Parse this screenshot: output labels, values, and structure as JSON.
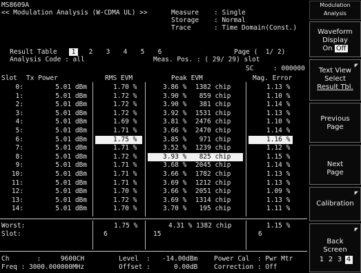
{
  "header": {
    "model": "MS8609A",
    "title": "<< Modulation Analysis (W-CDMA UL) >>",
    "rows": [
      {
        "label": "Measure",
        "value": ": Single"
      },
      {
        "label": "Storage",
        "value": ": Normal"
      },
      {
        "label": "Trace",
        "value": ": Time Domain(Const.)"
      }
    ]
  },
  "result": {
    "label": "Result Table",
    "pages": [
      "1",
      "2",
      "3",
      "4",
      "5",
      "6"
    ],
    "selected_page": "1",
    "page_indicator": "Page (  1/ 2)",
    "analysis_code": "Analysis Code : all",
    "meas_pos": "Meas. Pos. : ( 29/ 29) slot",
    "sc": "SC     : 000000"
  },
  "table": {
    "headers": {
      "slot": "Slot",
      "tx_power": "Tx Power",
      "rms_evm": "RMS EVM",
      "peak_evm": "Peak EVM",
      "mag_error": "Mag. Error"
    },
    "rows": [
      {
        "slot": "0:",
        "tx": "5.01 dBm",
        "rms": "1.70 %",
        "peak": "3.86 %",
        "chip": "1382 chip",
        "mag": "1.13 %"
      },
      {
        "slot": "1:",
        "tx": "5.01 dBm",
        "rms": "1.72 %",
        "peak": "3.90 %",
        "chip": "859 chip",
        "mag": "1.10 %"
      },
      {
        "slot": "2:",
        "tx": "5.01 dBm",
        "rms": "1.72 %",
        "peak": "3.90 %",
        "chip": "381 chip",
        "mag": "1.14 %"
      },
      {
        "slot": "3:",
        "tx": "5.01 dBm",
        "rms": "1.72 %",
        "peak": "3.92 %",
        "chip": "1531 chip",
        "mag": "1.13 %"
      },
      {
        "slot": "4:",
        "tx": "5.01 dBm",
        "rms": "1.69 %",
        "peak": "3.81 %",
        "chip": "2476 chip",
        "mag": "1.10 %"
      },
      {
        "slot": "5:",
        "tx": "5.01 dBm",
        "rms": "1.71 %",
        "peak": "3.66 %",
        "chip": "2470 chip",
        "mag": "1.14 %"
      },
      {
        "slot": "6:",
        "tx": "5.01 dBm",
        "rms": "1.75 %",
        "peak": "3.85 %",
        "chip": "971 chip",
        "mag": "1.16 %"
      },
      {
        "slot": "7:",
        "tx": "5.01 dBm",
        "rms": "1.71 %",
        "peak": "3.52 %",
        "chip": "1239 chip",
        "mag": "1.12 %"
      },
      {
        "slot": "8:",
        "tx": "5.01 dBm",
        "rms": "1.72 %",
        "peak": "3.93 %",
        "chip": "825 chip",
        "mag": "1.15 %"
      },
      {
        "slot": "9:",
        "tx": "5.01 dBm",
        "rms": "1.71 %",
        "peak": "3.68 %",
        "chip": "2045 chip",
        "mag": "1.14 %"
      },
      {
        "slot": "10:",
        "tx": "5.01 dBm",
        "rms": "1.71 %",
        "peak": "3.66 %",
        "chip": "1782 chip",
        "mag": "1.13 %"
      },
      {
        "slot": "11:",
        "tx": "5.01 dBm",
        "rms": "1.71 %",
        "peak": "3.69 %",
        "chip": "1212 chip",
        "mag": "1.13 %"
      },
      {
        "slot": "12:",
        "tx": "5.01 dBm",
        "rms": "1.70 %",
        "peak": "3.66 %",
        "chip": "2051 chip",
        "mag": "1.09 %"
      },
      {
        "slot": "13:",
        "tx": "5.01 dBm",
        "rms": "1.72 %",
        "peak": "3.69 %",
        "chip": "1314 chip",
        "mag": "1.13 %"
      },
      {
        "slot": "14:",
        "tx": "5.01 dBm",
        "rms": "1.70 %",
        "peak": "3.70 %",
        "chip": "195 chip",
        "mag": "1.11 %"
      }
    ],
    "highlight": {
      "rms": "6:",
      "peak": "8:",
      "mag": "6:"
    }
  },
  "worst": {
    "worst_label": "Worst:",
    "slot_label": "Slot:",
    "rms": "1.75 %",
    "rms_slot": "6",
    "peak": "4.31 % 1382 chip",
    "peak_slot": "15",
    "mag": "1.15 %",
    "mag_slot": "6"
  },
  "footer": {
    "ch": "Ch       :     9600CH",
    "freq": "Freq : 3000.000000MHz",
    "level": "Level  :   -14.00dBm",
    "offset": "Offset :      0.00dB",
    "power_cal": "Power Cal  : Pwr Mtr",
    "correction": "Correction : Off"
  },
  "softkeys": {
    "title_line1": "Modulation",
    "title_line2": "Analysis",
    "waveform_l1": "Waveform",
    "waveform_l2": "Display",
    "waveform_on": "On",
    "waveform_off": "Off",
    "textview_l1": "Text View",
    "textview_l2": "Select",
    "textview_l3": "Result Tbl.",
    "prev_l1": "Previous",
    "prev_l2": "Page",
    "next_l1": "Next",
    "next_l2": "Page",
    "calibration": "Calibration",
    "back_l1": "Back",
    "back_l2": "Screen",
    "screens": [
      "1",
      "2",
      "3",
      "4"
    ],
    "selected_screen": "4"
  }
}
